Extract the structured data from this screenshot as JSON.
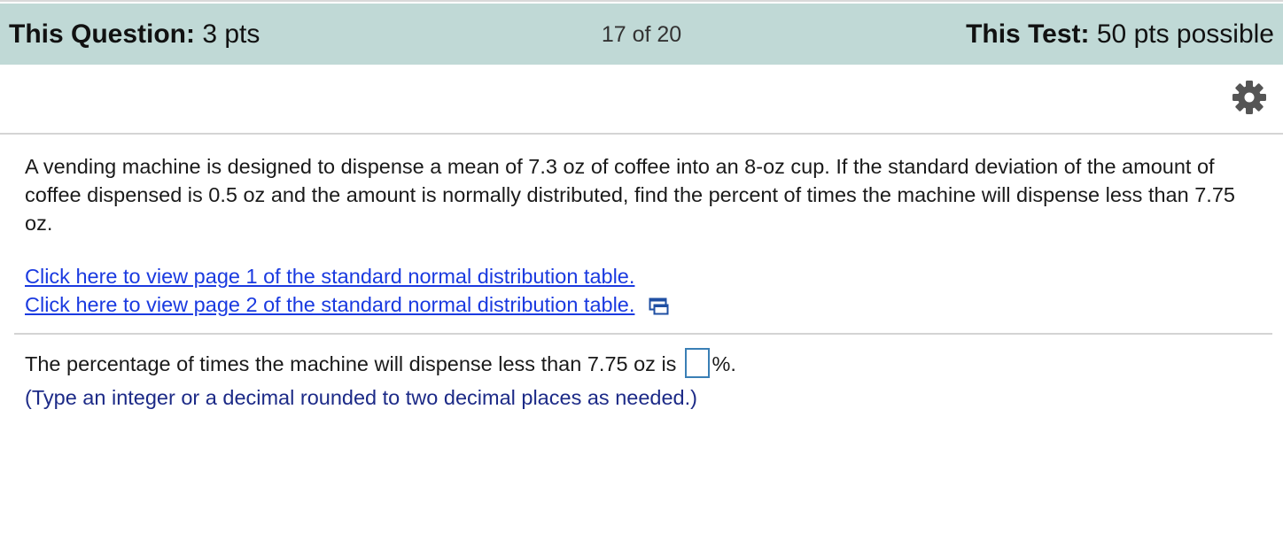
{
  "header": {
    "question_label": "This Question:",
    "question_points": "3 pts",
    "progress": "17 of 20",
    "test_label": "This Test:",
    "test_points": "50 pts possible",
    "background_color": "#c0d9d6"
  },
  "toolbar": {
    "settings_icon": "gear-icon"
  },
  "question": {
    "text": "A vending machine is designed to dispense a mean of 7.3 oz of coffee into an 8-oz cup. If the standard deviation of the amount of coffee dispensed is 0.5 oz and the amount is normally distributed, find the percent of times the machine will dispense less than 7.75 oz.",
    "links": [
      {
        "label": "Click here to view page 1 of the standard normal distribution table."
      },
      {
        "label": "Click here to view page 2 of the standard normal distribution table."
      }
    ],
    "link_color": "#1a3ae0",
    "popup_icon": "popup-window-icon"
  },
  "answer": {
    "prompt": "The percentage of times the machine will dispense less than 7.75 oz is",
    "input_value": "",
    "suffix": "%.",
    "hint": "(Type an integer or a decimal rounded to two decimal places as needed.)",
    "hint_color": "#1c2a87"
  }
}
